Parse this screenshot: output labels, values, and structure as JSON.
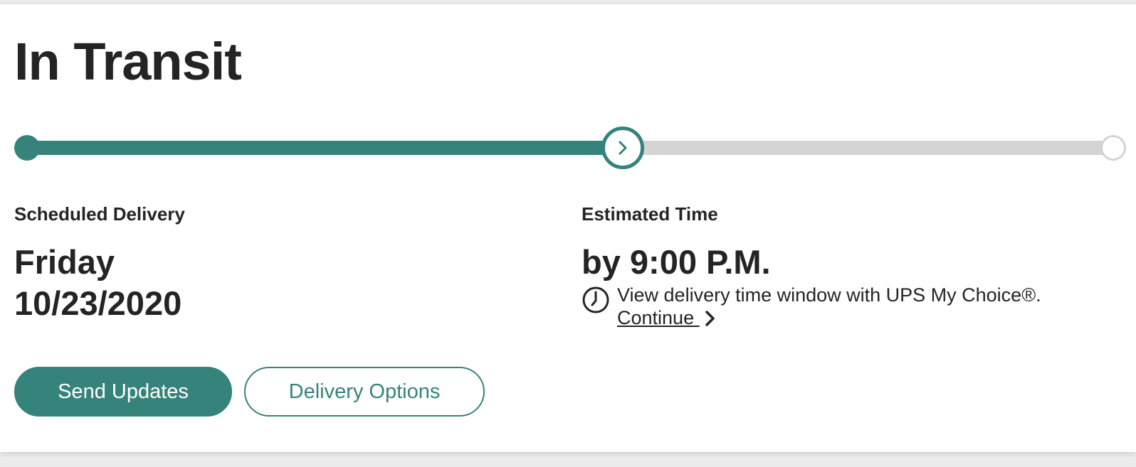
{
  "status": {
    "title": "In Transit",
    "progress_fraction": 0.55,
    "colors": {
      "accent": "#35837b",
      "track": "#d4d4d4",
      "text": "#242424"
    }
  },
  "delivery": {
    "label": "Scheduled Delivery",
    "day": "Friday",
    "date": "10/23/2020"
  },
  "estimated": {
    "label": "Estimated Time",
    "time": "by 9:00 P.M.",
    "my_choice_text": "View delivery time window with UPS My Choice®.",
    "continue_label": "Continue "
  },
  "actions": {
    "send_updates": "Send Updates",
    "delivery_options": "Delivery Options"
  },
  "icons": {
    "current_step": "chevron-right-icon",
    "time_window": "clock-icon",
    "continue": "chevron-right-icon"
  }
}
